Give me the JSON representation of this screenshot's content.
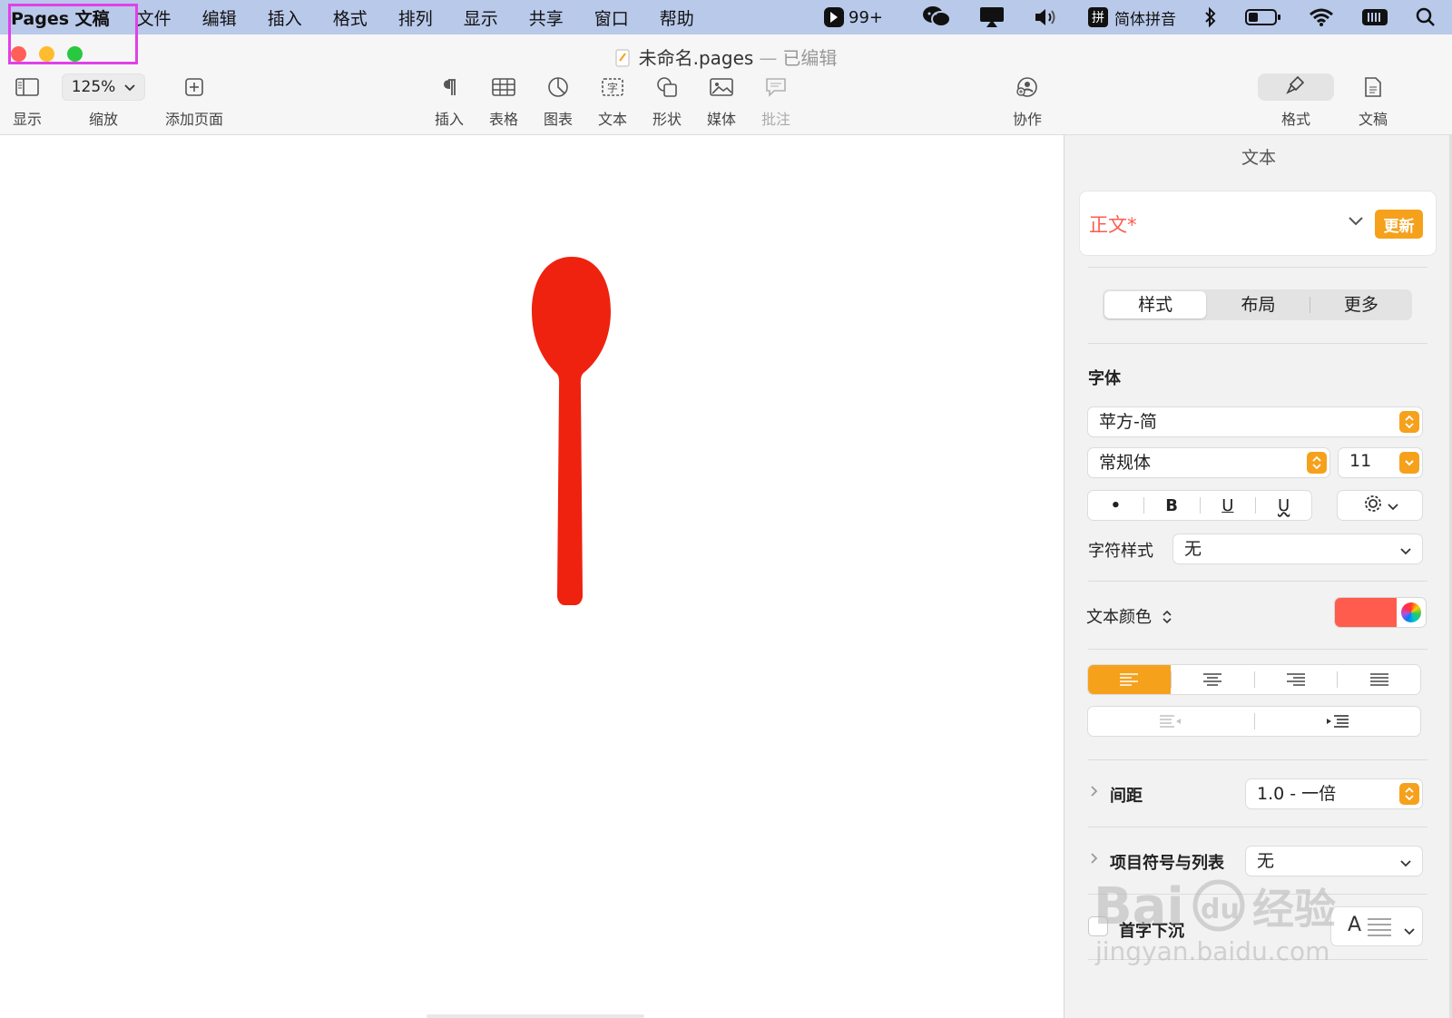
{
  "menubar": {
    "app_name": "Pages 文稿",
    "items": [
      "文件",
      "编辑",
      "插入",
      "格式",
      "排列",
      "显示",
      "共享",
      "窗口",
      "帮助"
    ],
    "status": {
      "badge_count": "99+",
      "input_method_label": "简体拼音"
    }
  },
  "window": {
    "doc_name": "未命名.pages",
    "doc_separator": "—",
    "doc_status": "已编辑"
  },
  "toolbar": {
    "view_label": "显示",
    "zoom_value": "125%",
    "zoom_label": "缩放",
    "add_page_label": "添加页面",
    "insert_label": "插入",
    "table_label": "表格",
    "chart_label": "图表",
    "text_label": "文本",
    "shape_label": "形状",
    "media_label": "媒体",
    "comment_label": "批注",
    "collaborate_label": "协作",
    "format_label": "格式",
    "document_label": "文稿"
  },
  "canvas": {
    "shape_color": "#ee220f"
  },
  "inspector": {
    "title": "文本",
    "paragraph_style": "正文*",
    "update_label": "更新",
    "tabs": [
      "样式",
      "布局",
      "更多"
    ],
    "font_section": "字体",
    "font_family": "苹方-简",
    "font_style": "常规体",
    "font_size": "11",
    "format_buttons": [
      "•",
      "B",
      "U",
      "U"
    ],
    "char_style_label": "字符样式",
    "char_style_value": "无",
    "text_color_label": "文本颜色",
    "text_color": "#ff5c4d",
    "spacing_label": "间距",
    "spacing_value": "1.0 - 一倍",
    "bullets_label": "项目符号与列表",
    "bullets_value": "无",
    "dropcap_label": "首字下沉",
    "dropcap_glyph": "A"
  },
  "colors": {
    "accent": "#f6a11c",
    "menubar_bg": "#b9c9ea",
    "highlight_box": "#e040e8"
  }
}
